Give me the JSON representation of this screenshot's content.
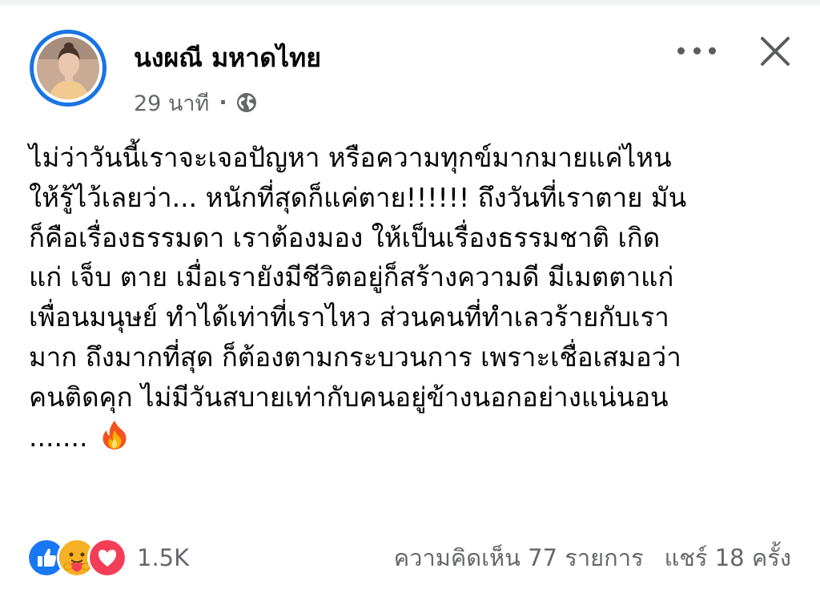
{
  "post": {
    "author_name": "นงผณี มหาดไทย",
    "timestamp": "29 นาที",
    "separator": "·",
    "privacy_icon": "globe-icon",
    "body_lines": [
      "ไม่ว่าวันนี้เราจะเจอปัญหา หรือความทุกข์มากมายแค่ไหน",
      "ให้รู้ไว้เลยว่า... หนักที่สุดก็แค่ตาย!!!!!! ถึงวันที่เราตาย มัน",
      "ก็คือเรื่องธรรมดา เราต้องมอง ให้เป็นเรื่องธรรมชาติ เกิด",
      "แก่ เจ็บ ตาย เมื่อเรายังมีชีวิตอยู่ก็สร้างความดี มีเมตตาแก่",
      "เพื่อนมนุษย์ ทำได้เท่าที่เราไหว ส่วนคนที่ทำเลวร้ายกับเรา",
      "มาก ถึงมากที่สุด ก็ต้องตามกระบวนการ เพราะเชื่อเสมอว่า",
      "คนติดคุก ไม่มีวันสบายเท่ากับคนอยู่ข้างนอกอย่างแน่นอน",
      "......."
    ],
    "trailing_emoji": "fire-emoji"
  },
  "header_actions": {
    "more_icon": "more-dots-icon",
    "close_icon": "close-icon"
  },
  "footer": {
    "reaction_icons": [
      "like-icon",
      "care-icon",
      "love-icon"
    ],
    "reaction_count": "1.5K",
    "comments_text": "ความคิดเห็น 77 รายการ",
    "shares_text": "แชร์ 18 ครั้ง"
  },
  "colors": {
    "accent": "#1b74e4",
    "meta_gray": "#65676b",
    "like_blue": "#1877f2",
    "love_red": "#f33e58",
    "care_yellow": "#f7b125"
  }
}
